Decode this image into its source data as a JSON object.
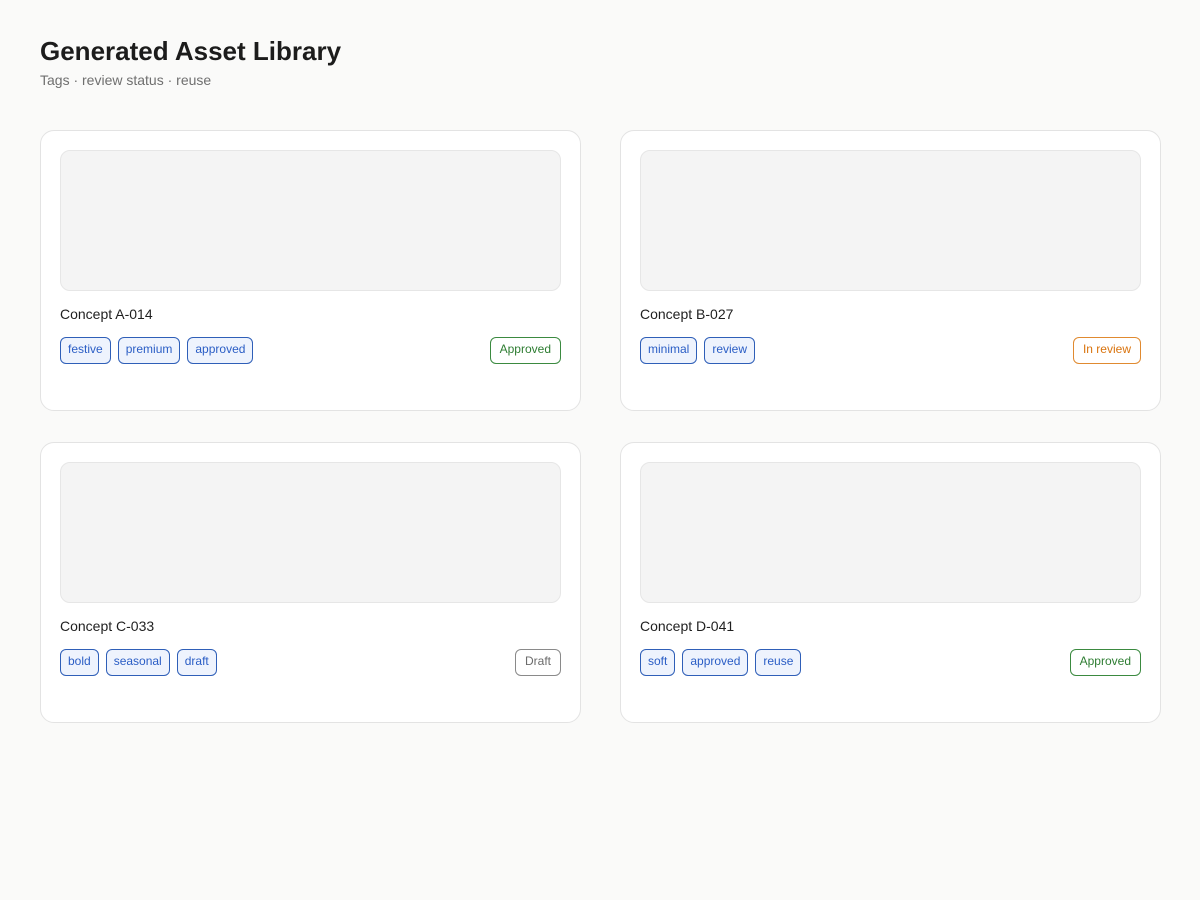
{
  "header": {
    "title": "Generated Asset Library",
    "subtitle": "Tags · review status · reuse"
  },
  "colors": {
    "approved": "#2e7d32",
    "in_review": "#d9730d",
    "draft": "#6b6b6b",
    "tag": "#2a5dc5"
  },
  "cards": [
    {
      "name": "Concept A-014",
      "tags": [
        "festive",
        "premium",
        "approved"
      ],
      "status": "Approved",
      "status_kind": "approved"
    },
    {
      "name": "Concept B-027",
      "tags": [
        "minimal",
        "review"
      ],
      "status": "In review",
      "status_kind": "review"
    },
    {
      "name": "Concept C-033",
      "tags": [
        "bold",
        "seasonal",
        "draft"
      ],
      "status": "Draft",
      "status_kind": "draft"
    },
    {
      "name": "Concept D-041",
      "tags": [
        "soft",
        "approved",
        "reuse"
      ],
      "status": "Approved",
      "status_kind": "approved"
    }
  ]
}
